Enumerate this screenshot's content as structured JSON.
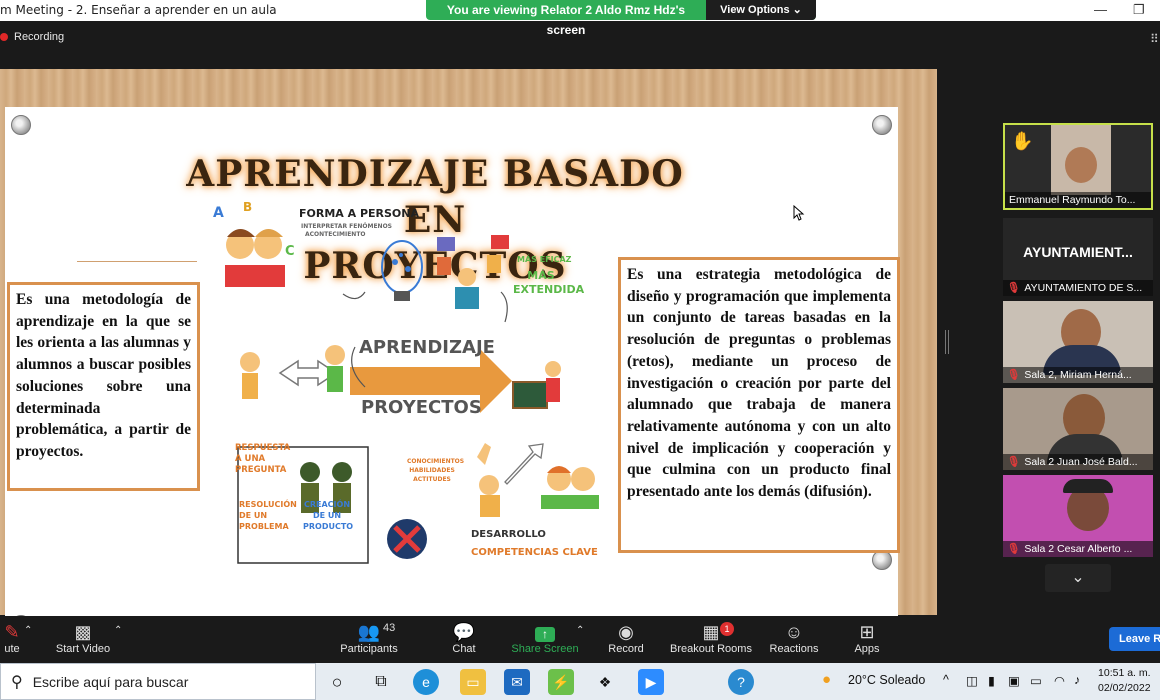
{
  "window": {
    "title": "m Meeting - 2. Enseñar a aprender en un aula",
    "minimize": "—",
    "restore": "❐"
  },
  "banner": {
    "message": "You are viewing Relator 2 Aldo Rmz Hdz's screen",
    "view_options": "View Options ⌄"
  },
  "recording": {
    "label": "Recording"
  },
  "slide": {
    "title_line1": "APRENDIZAJE BASADO EN",
    "title_line2": "PROYECTOS",
    "left_text": "Es una metodología de aprendizaje en la que se les orienta a las alumnas y alumnos a buscar posibles soluciones sobre una determinada problemática, a partir de proyectos.",
    "right_text": "Es una estrategia metodológica de diseño y programación que implementa un conjunto de tareas basadas en la resolución de preguntas o problemas (retos), mediante un proceso de investigación o creación por parte del alumnado que trabaja de manera relativamente autónoma y con un alto nivel de implicación y cooperación y que culmina con un producto final presentado ante los demás (difusión).",
    "illustration": {
      "forma": "FORMA A PERSONA",
      "forma_sub1": "INTERPRETAR FENÓMENOS",
      "forma_sub2": "ACONTECIMIENTO",
      "mas_eficaz": "MÁS EFICAZ",
      "mas_extendida": "MÁS EXTENDIDA",
      "aprendizaje": "APRENDIZAJE",
      "proyectos": "PROYECTOS",
      "respuesta": "RESPUESTA A UNA PREGUNTA",
      "resolucion": "RESOLUCIÓN DE UN PROBLEMA",
      "creacion": "CREACIÓN DE UN PRODUCTO",
      "conocimientos": "CONOCIMIENTOS HABILIDADES ACTITUDES",
      "desarrollo": "DESARROLLO",
      "competencias": "COMPETENCIAS CLAVE"
    }
  },
  "participants": [
    {
      "name": "Emmanuel Raymundo To...",
      "active": true,
      "hand": "✋"
    },
    {
      "name": "AYUNTAMIENTO DE S...",
      "big_label": "AYUNTAMIENT..."
    },
    {
      "name": "Sala 2, Miriam Herná..."
    },
    {
      "name": "Sala 2 Juan José Bald..."
    },
    {
      "name": "Sala 2 Cesar Alberto ..."
    }
  ],
  "toolbar": {
    "mute": "ute",
    "start_video": "Start Video",
    "participants": "Participants",
    "participants_count": "43",
    "chat": "Chat",
    "share_screen": "Share Screen",
    "record": "Record",
    "breakout_rooms": "Breakout Rooms",
    "breakout_badge": "1",
    "reactions": "Reactions",
    "apps": "Apps",
    "leave": "Leave R"
  },
  "taskbar": {
    "search_placeholder": "Escribe aquí para buscar",
    "weather": "20°C  Soleado",
    "time": "10:51 a. m.",
    "date": "02/02/2022"
  },
  "colors": {
    "banner_green": "#2ead56",
    "box_border": "#d9914e",
    "leave_blue": "#1c6bd6",
    "active_tile": "#c6e04a"
  }
}
